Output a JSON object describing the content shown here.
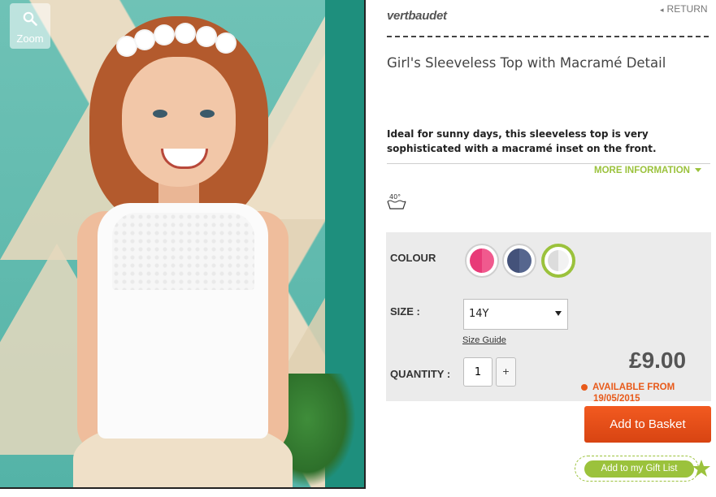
{
  "zoom": {
    "label": "Zoom",
    "icon": "magnifier-icon"
  },
  "header": {
    "brand": "vertbaudet",
    "return_label": "RETURN"
  },
  "product": {
    "title": "Girl's Sleeveless Top with Macramé Detail",
    "description": "Ideal for sunny days, this sleeveless top is very sophisticated with a macramé inset on the front.",
    "more_info_label": "MORE INFORMATION",
    "wash_symbol_text": "40°"
  },
  "options": {
    "colour_label": "COLOUR",
    "colours": [
      {
        "name": "pink",
        "hex": "#e83a78",
        "selected": false
      },
      {
        "name": "navy",
        "hex": "#4b5a80",
        "selected": false
      },
      {
        "name": "white",
        "hex": "#e8e8e8",
        "selected": true
      }
    ],
    "size_label": "SIZE :",
    "size_value": "14Y",
    "size_guide_label": "Size Guide",
    "quantity_label": "QUANTITY :",
    "quantity_value": "1",
    "quantity_plus": "+"
  },
  "pricing": {
    "price": "£9.00",
    "availability": "AVAILABLE FROM",
    "availability_date": "19/05/2015"
  },
  "actions": {
    "add_to_basket": "Add to Basket",
    "add_to_gift_list": "Add to my Gift List"
  },
  "colors": {
    "accent_green": "#9bc23c",
    "accent_orange": "#e85a1a"
  }
}
